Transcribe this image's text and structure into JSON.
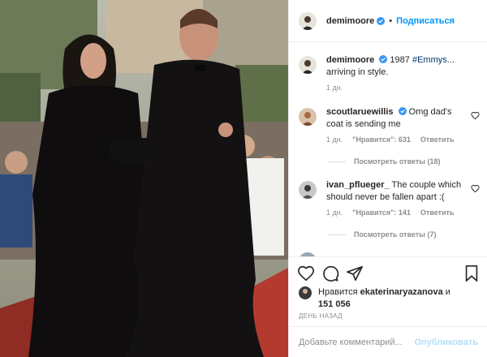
{
  "post": {
    "author": "demimoore",
    "follow_label": "Подписаться",
    "separator": "•",
    "caption": {
      "author": "demimoore",
      "year": "1987",
      "hashtag": "#Emmys...",
      "text": "arriving in style.",
      "time": "1 дн."
    },
    "comments": [
      {
        "user": "scoutlaruewillis",
        "verified": true,
        "text": "Omg dad's coat is sending me",
        "time": "1 дн.",
        "likes": "\"Нравится\": 631",
        "reply": "Ответить",
        "view_replies": "Посмотреть ответы (18)"
      },
      {
        "user": "ivan_pfluеger_",
        "verified": false,
        "text": "The couple which should never be fallen apart :(",
        "time": "1 дн.",
        "likes": "\"Нравится\": 141",
        "reply": "Ответить",
        "view_replies": "Посмотреть ответы (7)"
      }
    ],
    "likes": {
      "prefix": "Нравится",
      "user": "ekaterinaryazanova",
      "joiner": "и",
      "count": "151 056"
    },
    "date": "ДЕНЬ НАЗАД",
    "comment_input": {
      "placeholder": "Добавьте комментарий..."
    },
    "publish_label": "Опубликовать"
  },
  "icons": [
    "heart-icon",
    "comment-icon",
    "share-icon",
    "bookmark-icon",
    "verified-icon"
  ],
  "colors": {
    "link": "#0095f6",
    "publish_disabled": "#b2dffc",
    "muted": "#8e8e8e"
  }
}
